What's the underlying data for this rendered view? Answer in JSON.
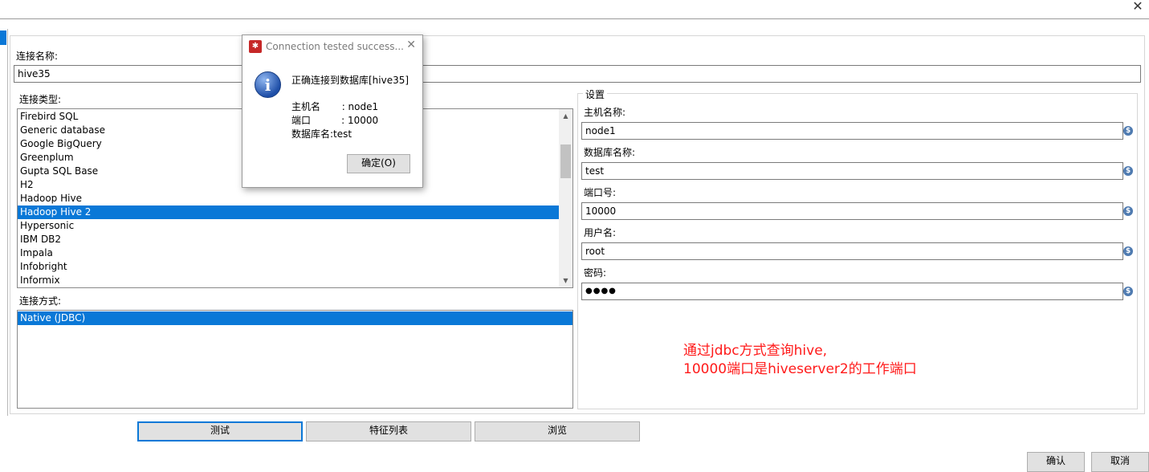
{
  "window": {
    "close_glyph": "✕"
  },
  "form": {
    "connection_name_label": "连接名称:",
    "connection_name_value": "hive35",
    "connection_type_label": "连接类型:",
    "connection_types": [
      "Firebird SQL",
      "Generic database",
      "Google BigQuery",
      "Greenplum",
      "Gupta SQL Base",
      "H2",
      "Hadoop Hive",
      "Hadoop Hive 2",
      "Hypersonic",
      "IBM DB2",
      "Impala",
      "Infobright",
      "Informix"
    ],
    "selected_type": "Hadoop Hive 2",
    "access_label": "连接方式:",
    "access_methods": [
      "Native (JDBC)"
    ],
    "selected_access": "Native (JDBC)"
  },
  "settings": {
    "group_label": "设置",
    "host_label": "主机名称:",
    "host_value": "node1",
    "db_label": "数据库名称:",
    "db_value": "test",
    "port_label": "端口号:",
    "port_value": "10000",
    "user_label": "用户名:",
    "user_value": "root",
    "password_label": "密码:",
    "password_value": "●●●●",
    "variable_icon": "$"
  },
  "buttons": {
    "test": "测试",
    "features": "特征列表",
    "explore": "浏览",
    "ok": "确认",
    "cancel": "取消"
  },
  "annotation": {
    "line1": "通过jdbc方式查询hive,",
    "line2": "10000端口是hiveserver2的工作端口",
    "color": "#ff1a1a"
  },
  "dialog": {
    "title": "Connection tested success...",
    "close_glyph": "✕",
    "message": "正确连接到数据库[hive35]",
    "host_line": "主机名       : node1",
    "port_line": "端口          : 10000",
    "db_line": "数据库名:test",
    "ok_button": "确定(O)",
    "info_glyph": "i"
  },
  "colors": {
    "selection": "#0a78d7",
    "button_face": "#e1e1e1"
  }
}
